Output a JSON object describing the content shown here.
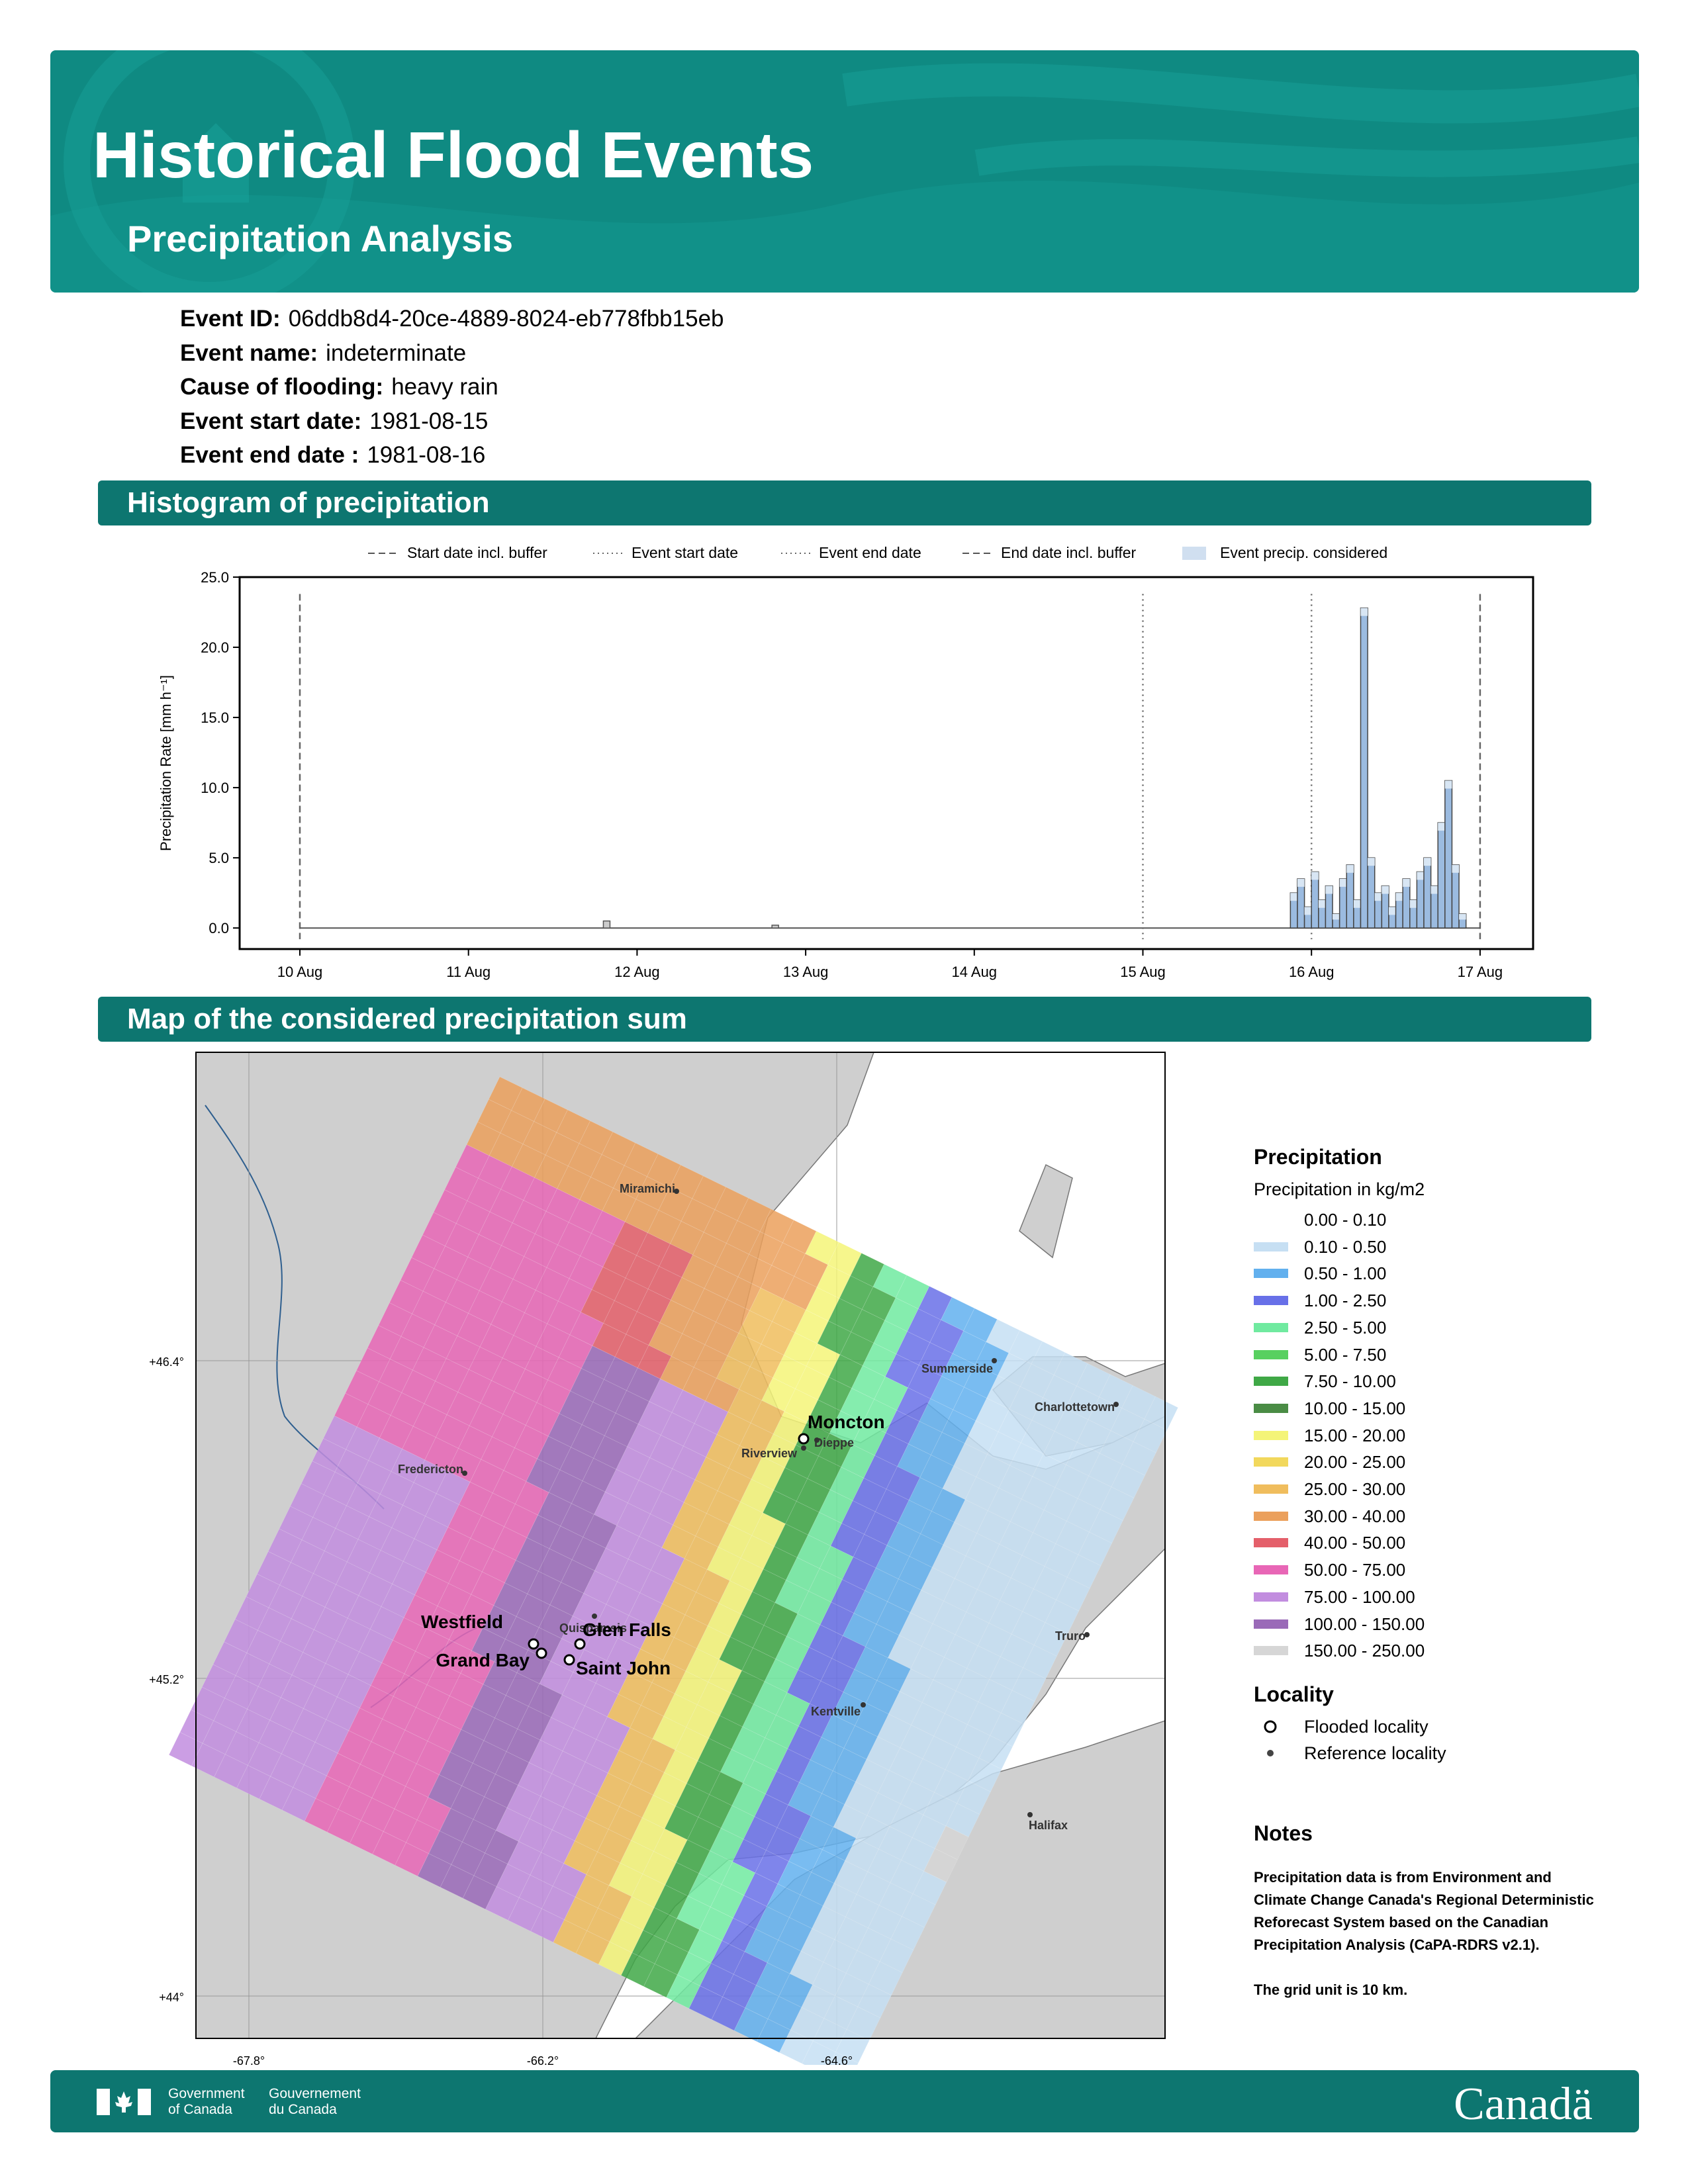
{
  "header": {
    "title": "Historical Flood Events",
    "subtitle": "Precipitation Analysis"
  },
  "event": {
    "id_label": "Event ID:",
    "id_value": "06ddb8d4-20ce-4889-8024-eb778fbb15eb",
    "name_label": "Event name:",
    "name_value": "indeterminate",
    "cause_label": "Cause of flooding:",
    "cause_value": "heavy rain",
    "start_label": "Event start date:",
    "start_value": "1981-08-15",
    "end_label": "Event end date :",
    "end_value": "1981-08-16"
  },
  "sections": {
    "histogram": "Histogram of precipitation",
    "map": "Map of the considered precipitation sum"
  },
  "chart_data": {
    "type": "bar",
    "ylabel": "Precipitation Rate [mm h⁻¹]",
    "ylim": [
      -1.5,
      25.0
    ],
    "yticks": [
      "25.0",
      "20.0",
      "15.0",
      "10.0",
      "5.0",
      "0.0"
    ],
    "xticks": [
      "10 Aug",
      "11 Aug",
      "12 Aug",
      "13 Aug",
      "14 Aug",
      "15 Aug",
      "16 Aug",
      "17 Aug"
    ],
    "legend": {
      "start_buffer": "Start date incl. buffer",
      "event_start": "Event start date",
      "event_end": "Event end date",
      "end_buffer": "End date incl. buffer",
      "considered": "Event precip. considered"
    },
    "x_start_hour": "1981-08-15 21:00",
    "hourly_values": [
      2.5,
      3.5,
      1.5,
      4.0,
      2.0,
      3.0,
      1.0,
      3.5,
      4.5,
      2.0,
      22.8,
      5.0,
      2.5,
      3.0,
      1.5,
      2.5,
      3.5,
      2.0,
      4.0,
      5.0,
      3.0,
      7.5,
      10.5,
      4.5,
      1.0
    ],
    "pre_event_bumps": [
      {
        "day": "12 Aug",
        "value": 0.5
      },
      {
        "day": "13 Aug",
        "value": 0.2
      }
    ]
  },
  "map": {
    "lat_labels": [
      "+46.4°",
      "+45.2°",
      "+44°"
    ],
    "lon_labels": [
      "-67.8°",
      "-66.2°",
      "-64.6°"
    ],
    "flooded": [
      "Moncton",
      "Westfield",
      "Glen Falls",
      "Grand Bay",
      "Saint John"
    ],
    "reference": [
      "Miramichi",
      "Summerside",
      "Charlottetown",
      "Dieppe",
      "Riverview",
      "Fredericton",
      "Quispamsis",
      "Truro",
      "Kentville",
      "Halifax"
    ]
  },
  "legend": {
    "precip_title": "Precipitation",
    "precip_unit": "Precipitation in kg/m2",
    "bins": [
      {
        "label": "0.00 - 0.10",
        "color": "#ffffff"
      },
      {
        "label": "0.10 - 0.50",
        "color": "#c6dff3"
      },
      {
        "label": "0.50 - 1.00",
        "color": "#62b0ee"
      },
      {
        "label": "1.00 - 2.50",
        "color": "#6870e8"
      },
      {
        "label": "2.50 - 5.00",
        "color": "#70eaa0"
      },
      {
        "label": "5.00 - 7.50",
        "color": "#58d060"
      },
      {
        "label": "7.50 - 10.00",
        "color": "#3fa846"
      },
      {
        "label": "10.00 - 15.00",
        "color": "#4a8c45"
      },
      {
        "label": "15.00 - 20.00",
        "color": "#f4f478"
      },
      {
        "label": "20.00 - 25.00",
        "color": "#f2d85c"
      },
      {
        "label": "25.00 - 30.00",
        "color": "#f0bd5d"
      },
      {
        "label": "30.00 - 40.00",
        "color": "#eba05c"
      },
      {
        "label": "40.00 - 50.00",
        "color": "#e45f6a"
      },
      {
        "label": "50.00 - 75.00",
        "color": "#e866b6"
      },
      {
        "label": "75.00 - 100.00",
        "color": "#c28ddf"
      },
      {
        "label": "100.00 - 150.00",
        "color": "#9a6ab8"
      },
      {
        "label": "150.00 - 250.00",
        "color": "#d6d6d6"
      }
    ],
    "locality_title": "Locality",
    "flooded_label": "Flooded locality",
    "reference_label": "Reference locality"
  },
  "notes": {
    "title": "Notes",
    "line1": "Precipitation data is from Environment and Climate Change Canada's Regional Deterministic Reforecast System based on the Canadian Precipitation Analysis (CaPA-RDRS v2.1).",
    "line2": "The grid unit is 10 km."
  },
  "footer": {
    "gov_en": "Government of Canada",
    "gov_fr": "Gouvernement du Canada",
    "wordmark": "Canadä"
  }
}
